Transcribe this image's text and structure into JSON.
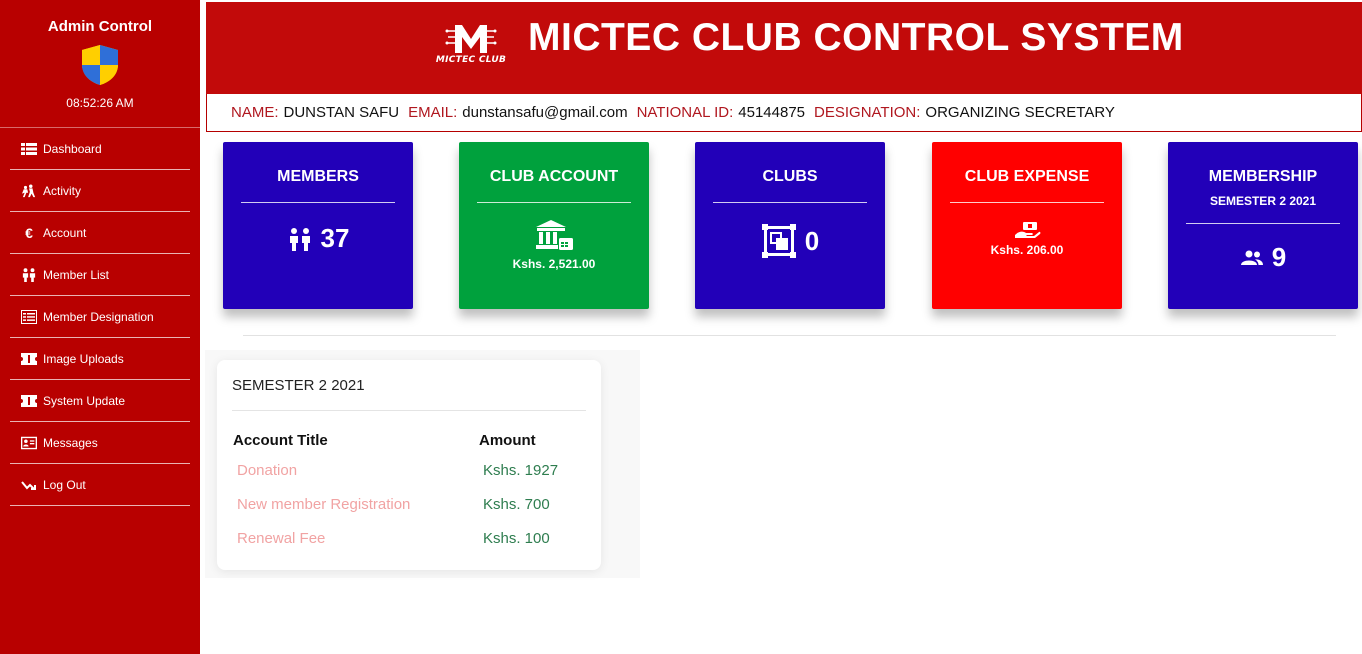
{
  "sidebar": {
    "title": "Admin Control",
    "time": "08:52:26 AM",
    "items": [
      {
        "label": "Dashboard",
        "icon": "table-icon"
      },
      {
        "label": "Activity",
        "icon": "activity-icon"
      },
      {
        "label": "Account",
        "icon": "euro-icon"
      },
      {
        "label": "Member List",
        "icon": "members-icon"
      },
      {
        "label": "Member Designation",
        "icon": "grid-icon"
      },
      {
        "label": "Image Uploads",
        "icon": "ticket-icon"
      },
      {
        "label": "System Update",
        "icon": "ticket-icon"
      },
      {
        "label": "Messages",
        "icon": "id-card-icon"
      },
      {
        "label": "Log Out",
        "icon": "logout-icon"
      }
    ]
  },
  "header": {
    "logo_text": "MICTEC CLUB",
    "title": "MICTEC CLUB CONTROL SYSTEM"
  },
  "profile": {
    "name_label": "NAME:",
    "name": "DUNSTAN SAFU",
    "email_label": "EMAIL:",
    "email": "dunstansafu@gmail.com",
    "id_label": "NATIONAL ID:",
    "id": "45144875",
    "designation_label": "DESIGNATION:",
    "designation": "ORGANIZING SECRETARY"
  },
  "cards": {
    "members": {
      "title": "MEMBERS",
      "value": "37",
      "color": "#2200b8"
    },
    "club_account": {
      "title": "CLUB ACCOUNT",
      "amount": "Kshs. 2,521.00",
      "color": "#00a13d"
    },
    "clubs": {
      "title": "CLUBS",
      "value": "0",
      "color": "#2200b8"
    },
    "club_expense": {
      "title": "CLUB EXPENSE",
      "amount": "Kshs. 206.00",
      "color": "#ff0000"
    },
    "membership": {
      "title": "MEMBERSHIP",
      "subtitle": "SEMESTER 2 2021",
      "value": "9",
      "color": "#2200b8"
    }
  },
  "semester_panel": {
    "title": "SEMESTER 2 2021",
    "col_title": "Account Title",
    "col_amount": "Amount",
    "rows": [
      {
        "title": "Donation",
        "amount": "Kshs. 1927"
      },
      {
        "title": "New member Registration",
        "amount": "Kshs. 700"
      },
      {
        "title": "Renewal Fee",
        "amount": "Kshs. 100"
      }
    ]
  },
  "colors": {
    "sidebar": "#b80000",
    "header": "#c20a0a",
    "label_red": "#b0171f",
    "amount_green": "#2e7d4f"
  }
}
